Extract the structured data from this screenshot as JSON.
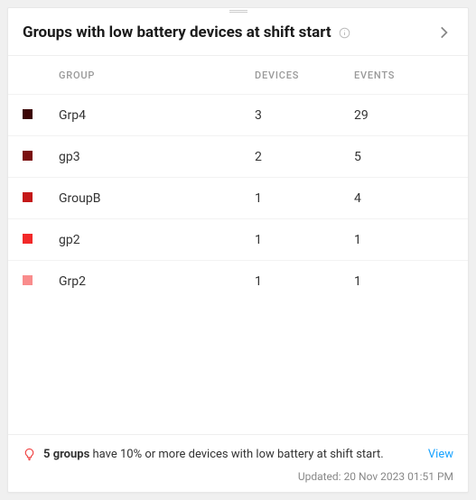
{
  "header": {
    "title": "Groups with low battery devices at shift start"
  },
  "columns": {
    "group": "GROUP",
    "devices": "DEVICES",
    "events": "EVENTS"
  },
  "rows": [
    {
      "color": "#3b0505",
      "group": "Grp4",
      "devices": "3",
      "events": "29"
    },
    {
      "color": "#7a0e0e",
      "group": "gp3",
      "devices": "2",
      "events": "5"
    },
    {
      "color": "#c41818",
      "group": "GroupB",
      "devices": "1",
      "events": "4"
    },
    {
      "color": "#f22929",
      "group": "gp2",
      "devices": "1",
      "events": "1"
    },
    {
      "color": "#f98c8c",
      "group": "Grp2",
      "devices": "1",
      "events": "1"
    }
  ],
  "footer": {
    "summary_bold": "5 groups",
    "summary_rest": " have 10% or more devices with low battery at shift start.",
    "view": "View",
    "updated": "Updated: 20 Nov 2023 01:51 PM"
  }
}
